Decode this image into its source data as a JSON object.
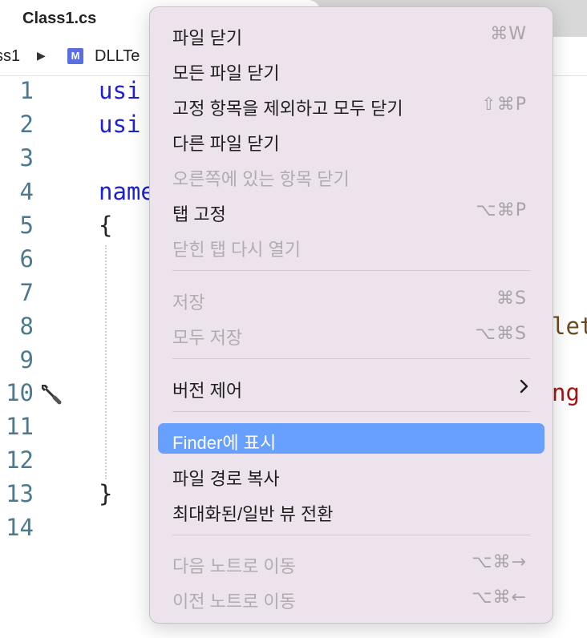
{
  "editor": {
    "tab_title": "Class1.cs",
    "breadcrumb": {
      "first": "ss1",
      "arrow": "▶",
      "icon_letter": "M",
      "second": "DLLTe"
    },
    "line_numbers": [
      "1",
      "2",
      "3",
      "4",
      "5",
      "6",
      "7",
      "8",
      "9",
      "10",
      "11",
      "12",
      "13",
      "14"
    ],
    "code": {
      "line1": "usi",
      "line2": "usi",
      "line4": "name",
      "line5": "{",
      "line8_tail": "let",
      "line10_tail": "ng",
      "line13": "}"
    }
  },
  "menu": {
    "items": [
      {
        "label": "파일 닫기",
        "shortcut": "⌘W",
        "enabled": true
      },
      {
        "label": "모든 파일 닫기",
        "shortcut": "",
        "enabled": true
      },
      {
        "label": "고정 항목을 제외하고 모두 닫기",
        "shortcut": "⇧⌘P",
        "enabled": true
      },
      {
        "label": "다른 파일 닫기",
        "shortcut": "",
        "enabled": true
      },
      {
        "label": "오른쪽에 있는 항목 닫기",
        "shortcut": "",
        "enabled": false
      },
      {
        "label": "탭 고정",
        "shortcut": "⌥⌘P",
        "enabled": true
      },
      {
        "label": "닫힌 탭 다시 열기",
        "shortcut": "",
        "enabled": false
      },
      {
        "label": "저장",
        "shortcut": "⌘S",
        "enabled": false
      },
      {
        "label": "모두 저장",
        "shortcut": "⌥⌘S",
        "enabled": false
      },
      {
        "label": "버전 제어",
        "shortcut": "",
        "enabled": true,
        "submenu": true
      },
      {
        "label": "Finder에 표시",
        "shortcut": "",
        "enabled": true,
        "highlighted": true
      },
      {
        "label": "파일 경로 복사",
        "shortcut": "",
        "enabled": true
      },
      {
        "label": "최대화된/일반 뷰 전환",
        "shortcut": "",
        "enabled": true
      },
      {
        "label": "다음 노트로 이동",
        "shortcut": "⌥⌘→",
        "enabled": false
      },
      {
        "label": "이전 노트로 이동",
        "shortcut": "⌥⌘←",
        "enabled": false
      }
    ]
  },
  "colors": {
    "highlight": "#67a0ff",
    "menu_bg": "#ece3ec",
    "line_number": "#4b7a8f",
    "keyword": "#1f1fd6"
  }
}
